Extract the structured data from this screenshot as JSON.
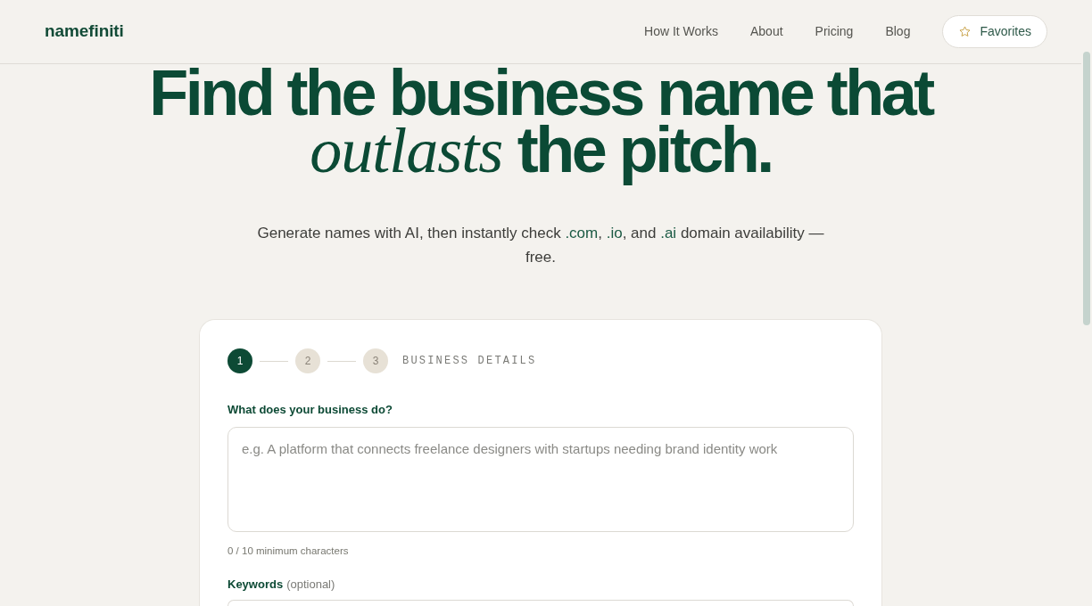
{
  "header": {
    "logo": "namefiniti",
    "nav_links": [
      "How It Works",
      "About",
      "Pricing",
      "Blog"
    ],
    "favorites_button": "Favorites"
  },
  "hero": {
    "headline": "Find the business name that *outlasts* the pitch.",
    "subtitle": [
      {
        "kind": "plain",
        "text": "Generate names with AI, then instantly check "
      },
      {
        "kind": "domain",
        "text": ".com"
      },
      {
        "kind": "plain",
        "text": ", "
      },
      {
        "kind": "domain",
        "text": ".io"
      },
      {
        "kind": "plain",
        "text": ", and "
      },
      {
        "kind": "domain",
        "text": ".ai"
      },
      {
        "kind": "plain",
        "text": " domain availability — free."
      }
    ]
  },
  "form": {
    "steps": [
      {
        "label": "1",
        "selected": true
      },
      {
        "label": "2",
        "selected": false
      },
      {
        "label": "3",
        "selected": false
      }
    ],
    "step_title": "BUSINESS DETAILS",
    "fields": [
      {
        "kind": "textarea",
        "label": "What does your business do?",
        "placeholder": "e.g. A platform that connects freelance designers with startups needing brand identity work",
        "helper": "0 / 10 minimum characters"
      },
      {
        "kind": "input",
        "label": "Keywords",
        "note": "(optional)"
      }
    ]
  }
}
